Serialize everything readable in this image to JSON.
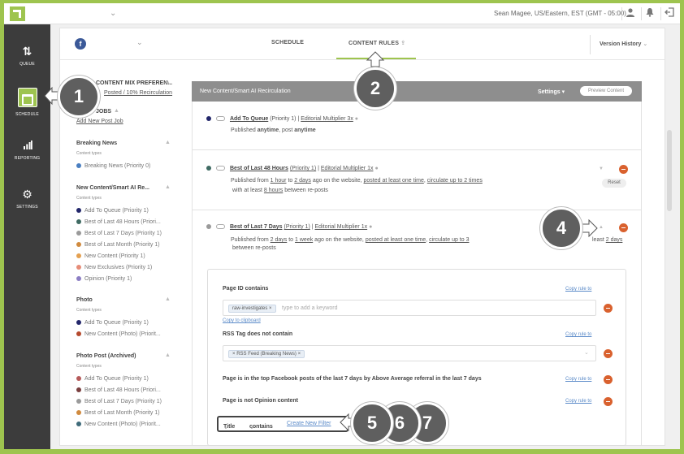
{
  "topbar": {
    "user": "Sean Magee, US/Eastern, EST (GMT - 05:00)",
    "icons": [
      "user-icon",
      "bell-icon",
      "logout-icon"
    ]
  },
  "sidebar": {
    "items": [
      {
        "label": "QUEUE",
        "icon": "sort-arrows-icon"
      },
      {
        "label": "SCHEDULE",
        "icon": "calendar-icon"
      },
      {
        "label": "REPORTING",
        "icon": "bar-chart-icon"
      },
      {
        "label": "SETTINGS",
        "icon": "gear-icon"
      }
    ]
  },
  "tabs": {
    "schedule": "SCHEDULE",
    "content_rules": "CONTENT RULES",
    "version_history": "Version History"
  },
  "left": {
    "mix_title": "CONTENT MIX PREFEREN...",
    "mix_link": "Posted / 10% Recirculation",
    "jobs_title": "JOBS",
    "add_job": "Add New Post Job",
    "content_types_label": "Content types",
    "groups": [
      {
        "title": "Breaking News",
        "items": [
          {
            "label": "Breaking News (Priority 0)",
            "color": "#4a7fc1"
          }
        ]
      },
      {
        "title": "New Content/Smart AI Re...",
        "items": [
          {
            "label": "Add To Queue (Priority 1)",
            "color": "#23276b"
          },
          {
            "label": "Best of Last 48 Hours (Priori...",
            "color": "#3f6b63"
          },
          {
            "label": "Best of Last 7 Days (Priority 1)",
            "color": "#9a9a9a"
          },
          {
            "label": "Best of Last Month (Priority 1)",
            "color": "#d08a3e"
          },
          {
            "label": "New Content (Priority 1)",
            "color": "#e4a050"
          },
          {
            "label": "New Exclusives (Priority 1)",
            "color": "#e68c78"
          },
          {
            "label": "Opinion (Priority 1)",
            "color": "#8c7ec4"
          }
        ]
      },
      {
        "title": "Photo",
        "items": [
          {
            "label": "Add To Queue (Priority 1)",
            "color": "#23276b"
          },
          {
            "label": "New Content (Photo) (Priorit...",
            "color": "#b54a2e"
          }
        ]
      },
      {
        "title": "Photo Post (Archived)",
        "items": [
          {
            "label": "Add To Queue (Priority 1)",
            "color": "#b65a5a"
          },
          {
            "label": "Best of Last 48 Hours (Priori...",
            "color": "#7a3f3f"
          },
          {
            "label": "Best of Last 7 Days (Priority 1)",
            "color": "#9a9a9a"
          },
          {
            "label": "Best of Last Month (Priority 1)",
            "color": "#d08a3e"
          },
          {
            "label": "New Content (Photo) (Priorit...",
            "color": "#3f6b7a"
          }
        ]
      }
    ]
  },
  "rules": {
    "header": "New Content/Smart AI Recirculation",
    "settings": "Settings",
    "preview": "Preview Content",
    "pipe": "|",
    "at_least": "with at least",
    "between": "between re-posts",
    "reset": "Reset",
    "r1": {
      "title": "Add To Queue",
      "priority": "(Priority 1)",
      "multiplier": "Editorial Multiplier 3x",
      "p1": "Published",
      "anytime1": "anytime",
      "mid": ", post",
      "anytime2": "anytime",
      "dot": "#23276b"
    },
    "r2": {
      "title": "Best of Last 48 Hours",
      "priority": "(Priority 1)",
      "multiplier": "Editorial Multiplier 1x",
      "p1": "Published from",
      "from": "1 hour",
      "to": "2 days",
      "site": "ago on the website,",
      "posted": "posted at least one time",
      "circ": "circulate up to 2 times",
      "hours": "8 hours",
      "dot": "#3f6b63"
    },
    "r3": {
      "title": "Best of Last 7 Days",
      "priority": "(Priority 1)",
      "multiplier": "Editorial Multiplier 1x",
      "p1": "Published from",
      "from": "2 days",
      "to": "1 week",
      "site": "ago on the website,",
      "posted": "posted at least one time",
      "circ": "circulate up to 3",
      "tail": "least",
      "days": "2 days",
      "dot": "#9a9a9a"
    },
    "to_word": "to"
  },
  "filters": {
    "f1": {
      "label": "Page ID contains",
      "tag": "raw-investigates",
      "placeholder": "type to add a keyword",
      "copy_clipboard": "Copy to clipboard"
    },
    "f2": {
      "label": "RSS Tag does not contain",
      "tag": "RSS Feed (Breaking News)"
    },
    "f3": {
      "label": "Page is in the top Facebook posts of the last 7 days by Above Average referral in the last 7 days"
    },
    "f4": {
      "label": "Page is not Opinion content"
    },
    "copy_rule": "Copy rule to",
    "new_filter": {
      "field": "Title",
      "op": "contains",
      "link": "Create New Filter"
    }
  },
  "callouts": [
    "1",
    "2",
    "4",
    "5",
    "6",
    "7"
  ]
}
